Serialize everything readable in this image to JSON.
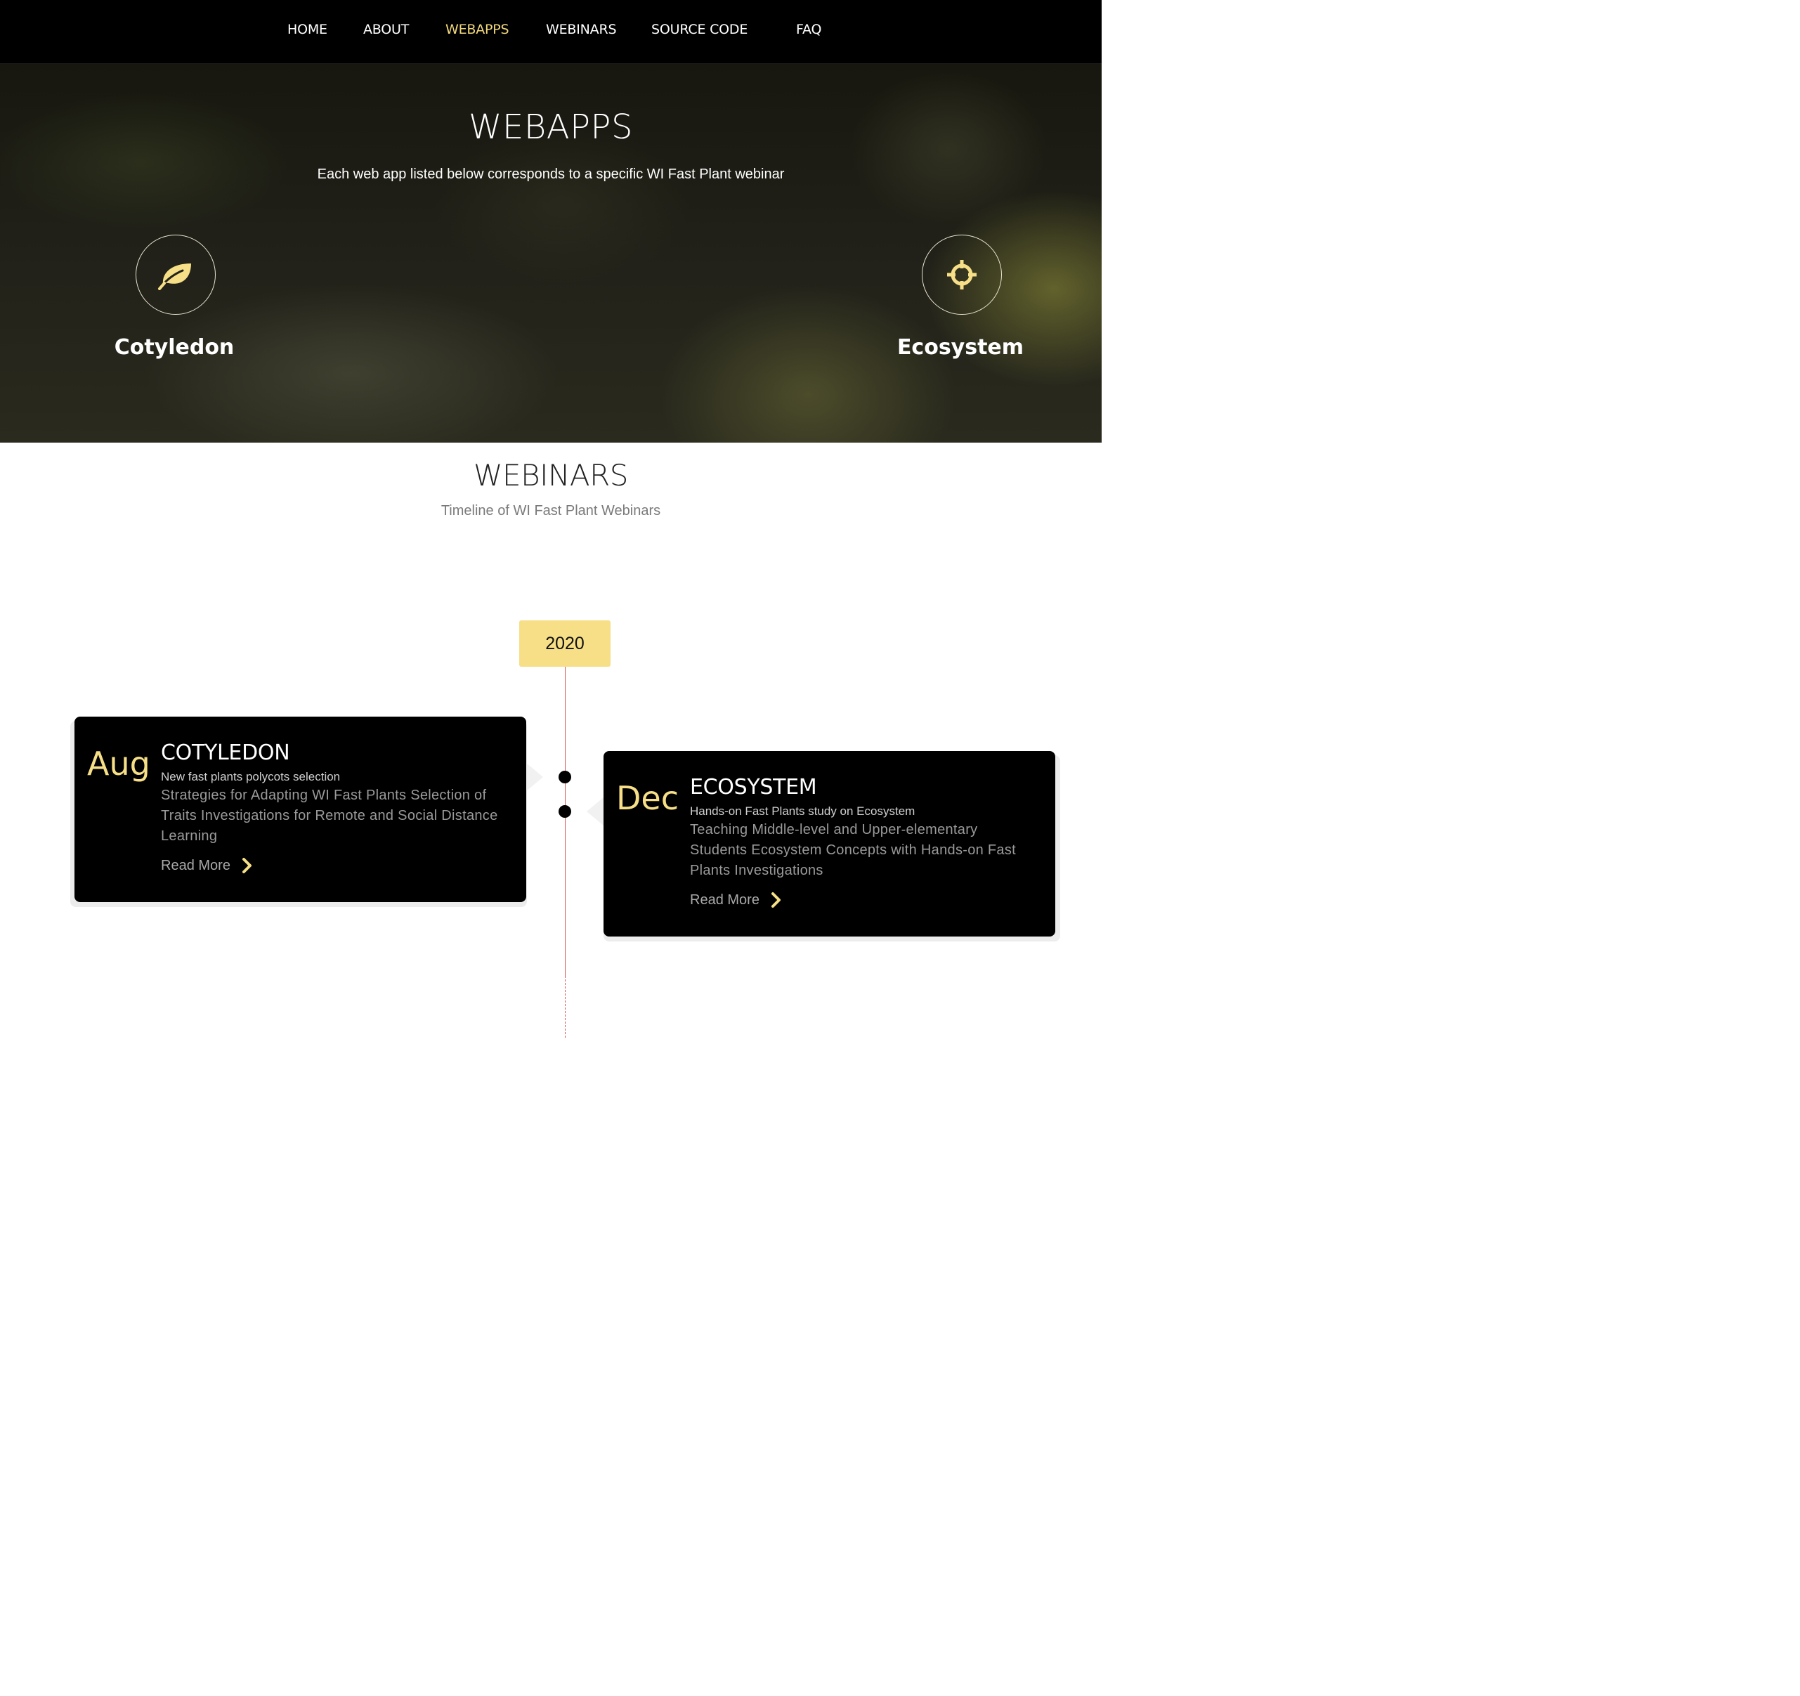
{
  "nav": {
    "items": [
      {
        "label": "HOME"
      },
      {
        "label": "ABOUT"
      },
      {
        "label": "WEBAPPS"
      },
      {
        "label": "WEBINARS"
      },
      {
        "label": "SOURCE CODE"
      },
      {
        "label": "FAQ"
      }
    ],
    "active": "WEBAPPS"
  },
  "hero": {
    "title": "WEBAPPS",
    "subtitle": "Each web app listed below corresponds to a specific WI Fast Plant webinar",
    "apps": [
      {
        "label": "Cotyledon",
        "icon": "leaf-icon"
      },
      {
        "label": "Ecosystem",
        "icon": "crosshair-icon"
      }
    ]
  },
  "webinars": {
    "title": "WEBINARS",
    "subtitle": "Timeline of WI Fast Plant Webinars",
    "year": "2020",
    "entries": [
      {
        "month": "Aug",
        "title": "COTYLEDON",
        "subtitle": "New fast plants polycots selection",
        "description": "Strategies for Adapting WI Fast Plants Selection of Traits Investigations for Remote and Social Distance Learning",
        "link": "Read More"
      },
      {
        "month": "Dec",
        "title": "ECOSYSTEM",
        "subtitle": "Hands-on Fast Plants study on Ecosystem",
        "description": "Teaching Middle-level and Upper-elementary Students Ecosystem Concepts with Hands-on Fast Plants Investigations",
        "link": "Read More"
      }
    ]
  },
  "colors": {
    "accent": "#f6df86",
    "nav_bg": "#000000",
    "timeline": "#d95858"
  }
}
